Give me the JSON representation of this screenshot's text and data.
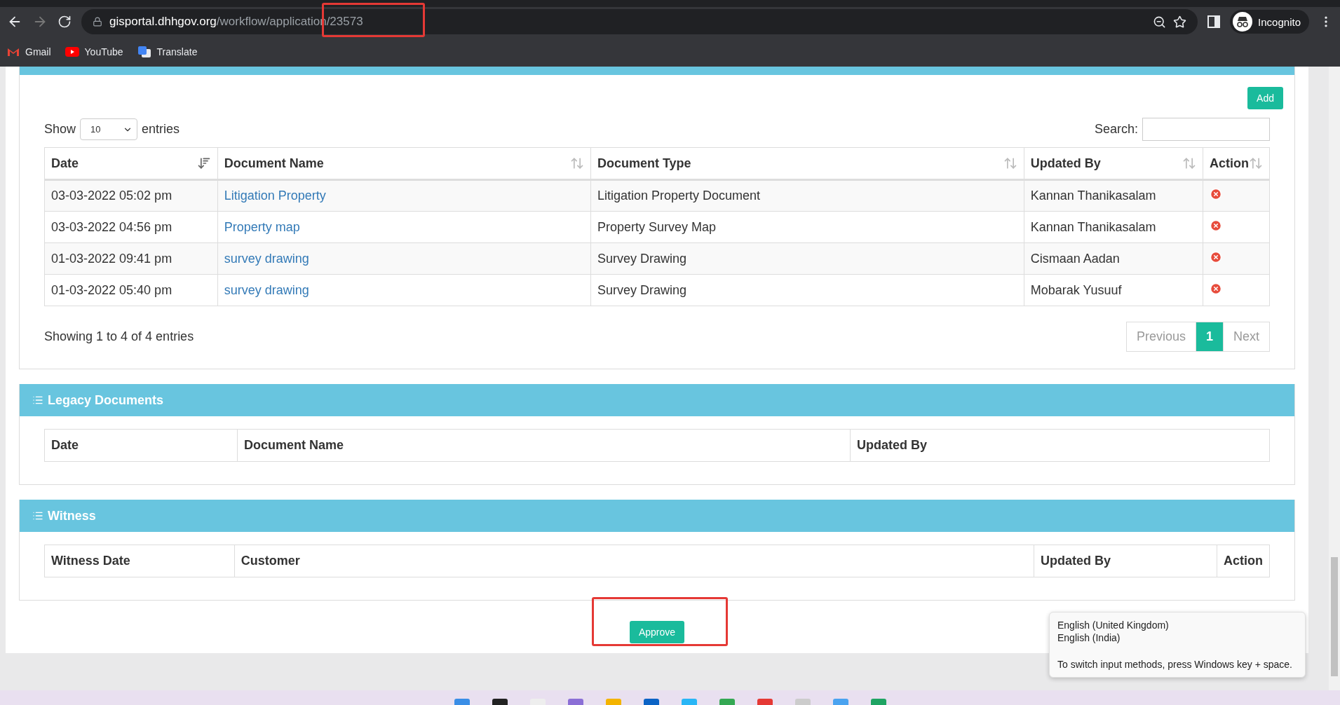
{
  "browser": {
    "url_host": "gisportal.dhhgov.org",
    "url_path": "/workflow/application/23573",
    "profile": "Incognito",
    "bookmarks": [
      {
        "label": "Gmail",
        "kind": "gmail"
      },
      {
        "label": "YouTube",
        "kind": "youtube"
      },
      {
        "label": "Translate",
        "kind": "translate"
      }
    ]
  },
  "documents": {
    "add_button": "Add",
    "show_label": "Show",
    "page_size": "10",
    "entries_label": "entries",
    "search_label": "Search:",
    "columns": [
      {
        "label": "Date",
        "sorted": true
      },
      {
        "label": "Document Name",
        "sorted": false
      },
      {
        "label": "Document Type",
        "sorted": false
      },
      {
        "label": "Updated By",
        "sorted": false
      },
      {
        "label": "Action",
        "sorted": false
      }
    ],
    "rows": [
      {
        "date": "03-03-2022 05:02 pm",
        "name": "Litigation Property",
        "type": "Litigation Property Document",
        "updated_by": "Kannan Thanikasalam"
      },
      {
        "date": "03-03-2022 04:56 pm",
        "name": "Property map",
        "type": "Property Survey Map",
        "updated_by": "Kannan Thanikasalam"
      },
      {
        "date": "01-03-2022 09:41 pm",
        "name": "survey drawing",
        "type": "Survey Drawing",
        "updated_by": "Cismaan Aadan"
      },
      {
        "date": "01-03-2022 05:40 pm",
        "name": "survey drawing",
        "type": "Survey Drawing",
        "updated_by": "Mobarak Yusuuf"
      }
    ],
    "info": "Showing 1 to 4 of 4 entries",
    "pagination": [
      {
        "label": "Previous",
        "selected": false
      },
      {
        "label": "1",
        "selected": true
      },
      {
        "label": "Next",
        "selected": false
      }
    ]
  },
  "legacy": {
    "title": "Legacy Documents",
    "columns": [
      "Date",
      "Document Name",
      "Updated By"
    ]
  },
  "witness": {
    "title": "Witness",
    "columns": [
      "Witness Date",
      "Customer",
      "Updated By",
      "Action"
    ]
  },
  "approve_button": "Approve",
  "input_tooltip": {
    "languages": [
      "English (United Kingdom)",
      "English (India)"
    ],
    "hint": "To switch input methods, press Windows key + space."
  }
}
